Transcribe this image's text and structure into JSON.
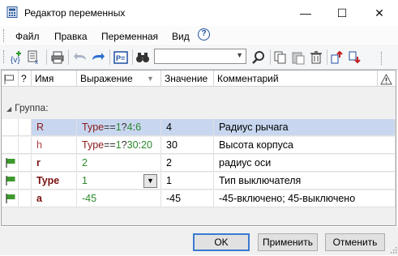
{
  "window": {
    "title": "Редактор переменных",
    "minimize": "—",
    "maximize": "☐",
    "close": "✕"
  },
  "menu": {
    "items": [
      "Файл",
      "Правка",
      "Переменная",
      "Вид"
    ],
    "help": "?"
  },
  "toolbar": {
    "search_value": ""
  },
  "grid": {
    "headers": {
      "flag": "",
      "q": "?",
      "name": "Имя",
      "expression": "Выражение",
      "value": "Значение",
      "comment": "Комментарий",
      "warn": "!"
    },
    "group_label": "Группа:",
    "rows": [
      {
        "name": "R",
        "expression": "Type==1?4:6",
        "value": "4",
        "comment": "Радиус рычага",
        "flag": false,
        "name_color": "#8b1a1a",
        "name_bold": false
      },
      {
        "name": "h",
        "expression": "Type==1?30:20",
        "value": "30",
        "comment": "Высота корпуса",
        "flag": false,
        "name_color": "#b04040",
        "name_bold": false
      },
      {
        "name": "r",
        "expression": "2",
        "value": "2",
        "comment": "радиус оси",
        "flag": true,
        "name_color": "#7a1010",
        "name_bold": true
      },
      {
        "name": "Type",
        "expression": "1",
        "value": "1",
        "comment": "Тип выключателя",
        "flag": true,
        "name_color": "#7a1010",
        "name_bold": true
      },
      {
        "name": "a",
        "expression": "-45",
        "value": "-45",
        "comment": "-45-включено; 45-выключено",
        "flag": true,
        "name_color": "#7a1010",
        "name_bold": true
      }
    ],
    "expr_tokens": [
      [
        {
          "t": "Type",
          "c": "#8b1a1a"
        },
        {
          "t": "==",
          "c": "#333333"
        },
        {
          "t": "1",
          "c": "#2a8a2a"
        },
        {
          "t": "?",
          "c": "#333333"
        },
        {
          "t": "4",
          "c": "#2a8a2a"
        },
        {
          "t": ":",
          "c": "#333333"
        },
        {
          "t": "6",
          "c": "#2a8a2a"
        }
      ],
      [
        {
          "t": "Type",
          "c": "#8b1a1a"
        },
        {
          "t": "==",
          "c": "#333333"
        },
        {
          "t": "1",
          "c": "#2a8a2a"
        },
        {
          "t": "?",
          "c": "#333333"
        },
        {
          "t": "30",
          "c": "#2a8a2a"
        },
        {
          "t": ":",
          "c": "#333333"
        },
        {
          "t": "20",
          "c": "#2a8a2a"
        }
      ],
      [
        {
          "t": "2",
          "c": "#2a8a2a"
        }
      ],
      [
        {
          "t": "1",
          "c": "#2a8a2a"
        }
      ],
      [
        {
          "t": "-45",
          "c": "#2a8a2a"
        }
      ]
    ]
  },
  "buttons": {
    "ok": "OK",
    "apply": "Применить",
    "cancel": "Отменить"
  },
  "colors": {
    "selected_row": "#c8d7ef",
    "flag_green": "#3c9a2c",
    "accent": "#3a7ad0"
  }
}
